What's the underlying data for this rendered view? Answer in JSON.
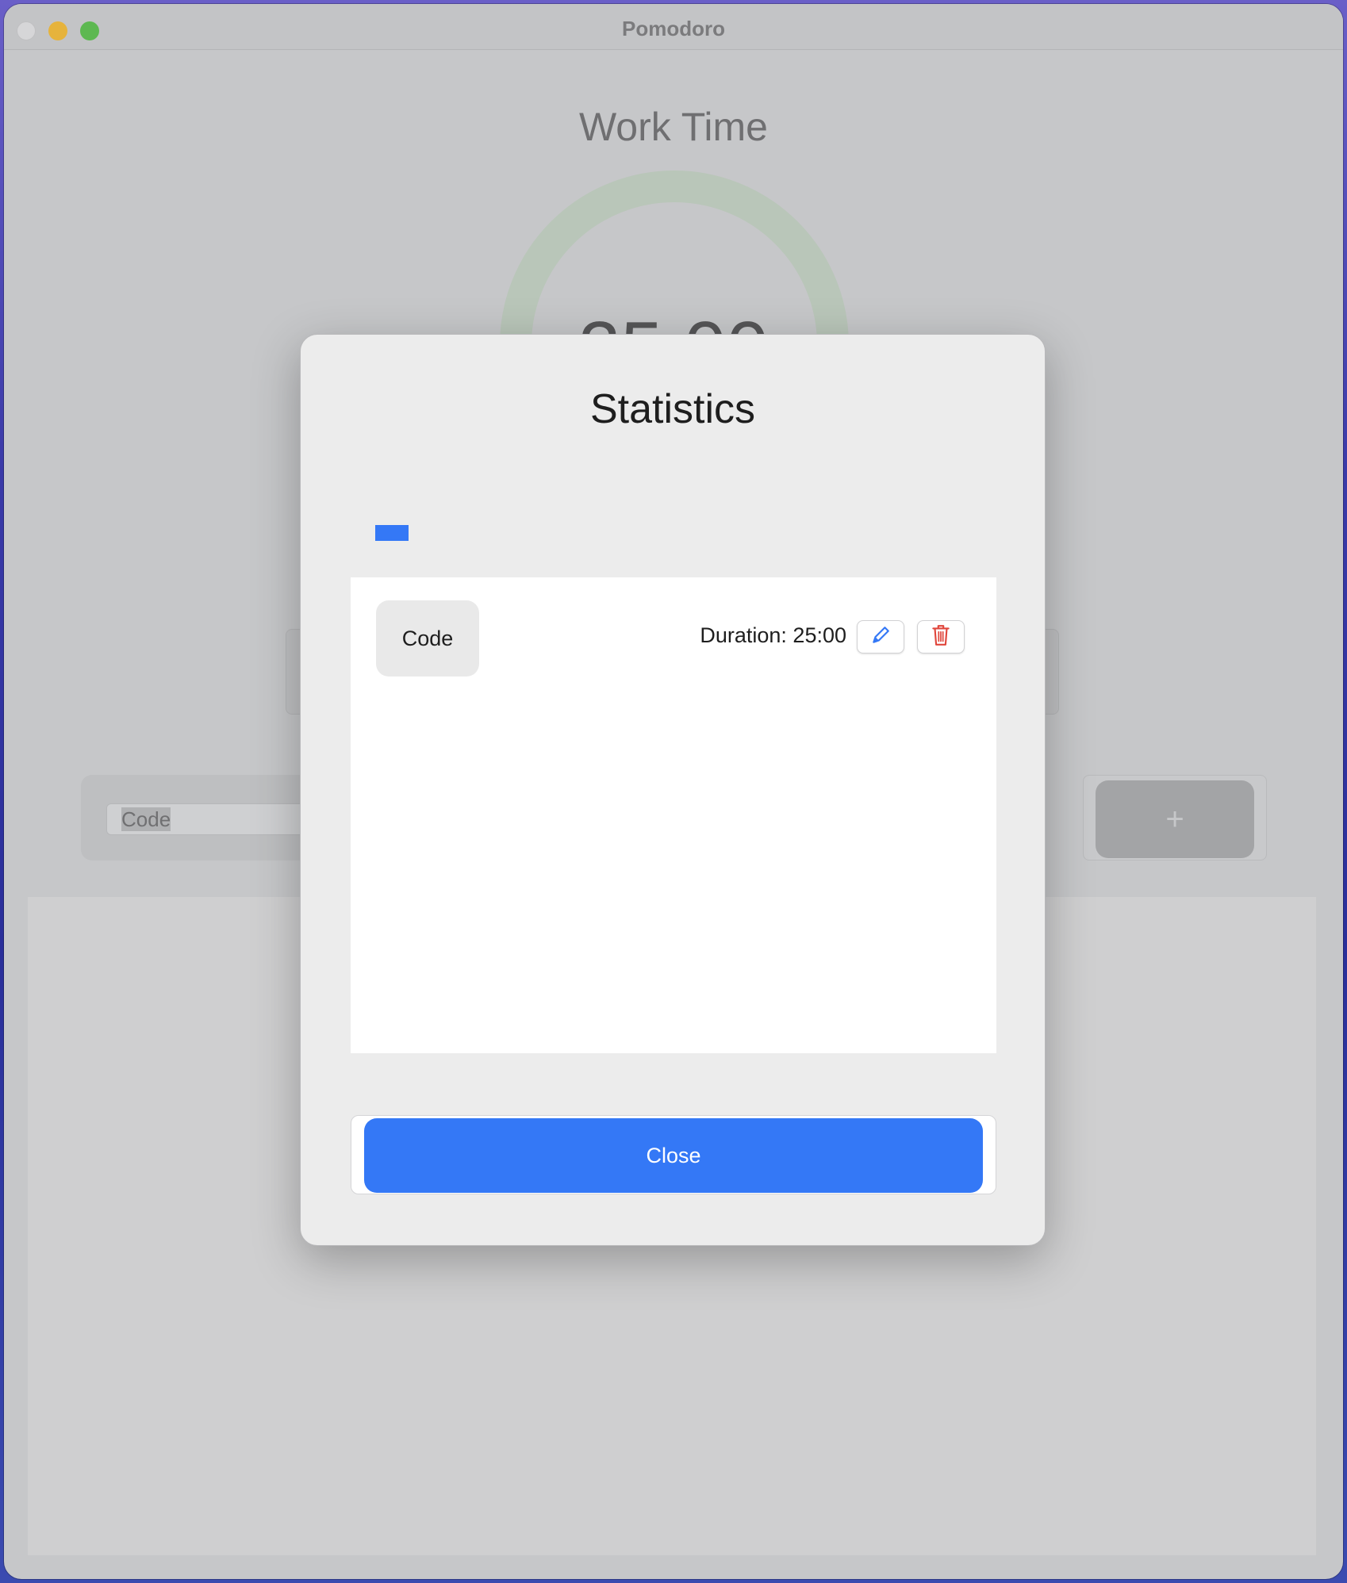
{
  "window": {
    "title": "Pomodoro"
  },
  "background": {
    "heading": "Work Time",
    "timer": "25:00",
    "task_input_value": "Code",
    "add_button_label": "+"
  },
  "modal": {
    "title": "Statistics",
    "legend_color": "#3478f6",
    "entries": [
      {
        "task": "Code",
        "duration": "Duration: 25:00"
      }
    ],
    "close_label": "Close"
  },
  "icons": {
    "edit": "pencil-icon",
    "delete": "trash-icon"
  },
  "colors": {
    "accent": "#3478f6",
    "delete": "#e0463c"
  }
}
